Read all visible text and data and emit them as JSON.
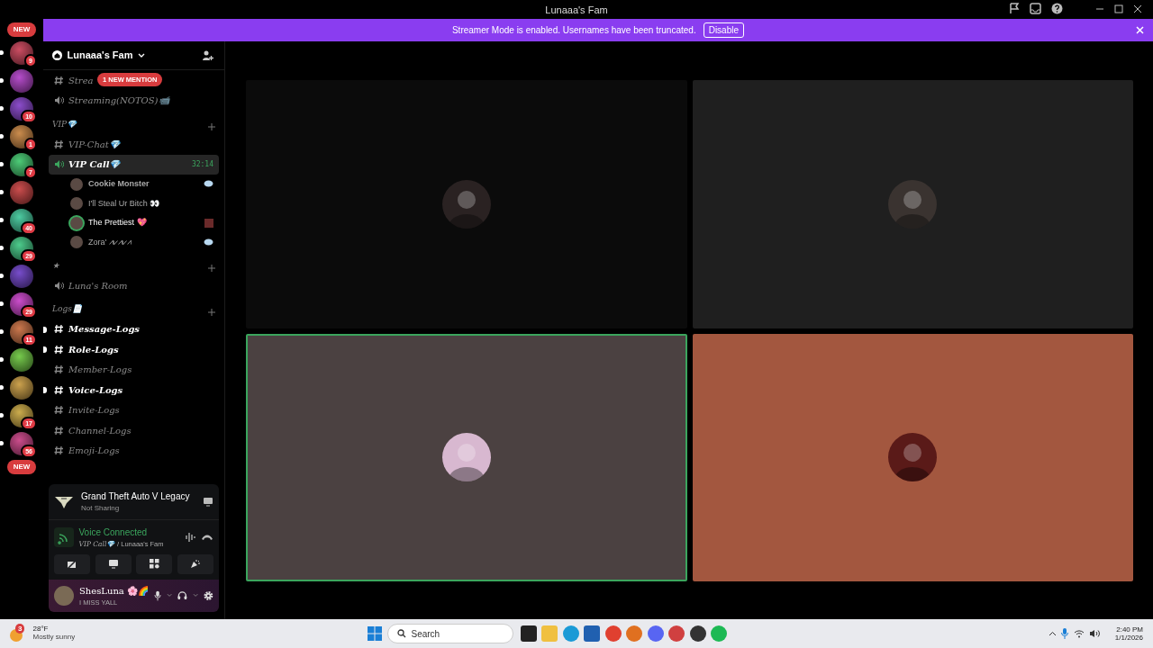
{
  "window": {
    "title": "Lunaaa's Fam"
  },
  "banner": {
    "text": "Streamer Mode is enabled. Usernames have been truncated.",
    "button": "Disable"
  },
  "servers": {
    "top_pill": "NEW",
    "bottom_pill": "NEW",
    "items": [
      {
        "badge": "9",
        "unread": true
      },
      {
        "unread": true
      },
      {
        "badge": "10",
        "unread": true
      },
      {
        "badge": "1",
        "unread": true
      },
      {
        "badge": "7",
        "unread": true
      },
      {
        "unread": true
      },
      {
        "badge": "40",
        "unread": true
      },
      {
        "badge": "29",
        "unread": true
      },
      {
        "unread": true
      },
      {
        "badge": "29",
        "unread": true
      },
      {
        "badge": "11",
        "unread": true
      },
      {
        "unread": true
      },
      {
        "unread": true
      },
      {
        "badge": "17",
        "unread": true
      },
      {
        "badge": "56",
        "unread": true
      }
    ]
  },
  "guild": {
    "name": "Lunaaa's Fam",
    "mention_pill": "1 NEW MENTION"
  },
  "channels": [
    {
      "kind": "text",
      "name": "Strea",
      "unread": false,
      "selected": false
    },
    {
      "kind": "voice",
      "name": "Streaming(NOTOS)📹",
      "unread": false,
      "selected": false
    },
    {
      "kind": "category",
      "name": "VIP💎"
    },
    {
      "kind": "text",
      "name": "VIP-Chat💎",
      "unread": false,
      "selected": false
    },
    {
      "kind": "voice",
      "name": "VIP Call💎",
      "unread": true,
      "selected": true,
      "timer": "32:14",
      "children": [
        {
          "name": "Cookie Monster",
          "speaking": false,
          "streaming": true,
          "video": false
        },
        {
          "name": "I'll Steal Ur Bitch 👀",
          "speaking": false,
          "streaming": false,
          "video": false
        },
        {
          "name": "The Prettiest 💖",
          "speaking": true,
          "streaming": false,
          "video": true
        },
        {
          "name": "Zora' ⩘⩗⩘⩗⩘",
          "speaking": false,
          "streaming": true,
          "video": false
        }
      ]
    },
    {
      "kind": "category",
      "name": "★"
    },
    {
      "kind": "voice",
      "name": "Luna's Room",
      "unread": false,
      "selected": false
    },
    {
      "kind": "category",
      "name": "Logs📄"
    },
    {
      "kind": "text",
      "name": "Message-Logs",
      "unread": true,
      "selected": false
    },
    {
      "kind": "text",
      "name": "Role-Logs",
      "unread": true,
      "selected": false
    },
    {
      "kind": "text",
      "name": "Member-Logs",
      "unread": false,
      "selected": false
    },
    {
      "kind": "text",
      "name": "Voice-Logs",
      "unread": true,
      "selected": false
    },
    {
      "kind": "text",
      "name": "Invite-Logs",
      "unread": false,
      "selected": false
    },
    {
      "kind": "text",
      "name": "Channel-Logs",
      "unread": false,
      "selected": false
    },
    {
      "kind": "text",
      "name": "Emoji-Logs",
      "unread": false,
      "selected": false
    }
  ],
  "activity": {
    "title": "Grand Theft Auto V Legacy",
    "subtitle": "Not Sharing"
  },
  "voice": {
    "status": "Voice Connected",
    "channel": "VIP Call💎",
    "server": "/ Lunaaa's Fam"
  },
  "user": {
    "name": "ShesLuna 🌸🌈",
    "status": "I MISS YALL"
  },
  "tiles": [
    {
      "color": "#0b0b0b",
      "speaking": false
    },
    {
      "color": "#1f1f1f",
      "speaking": false
    },
    {
      "color": "#4b4141",
      "speaking": true
    },
    {
      "color": "#a3573f",
      "speaking": false
    }
  ],
  "taskbar": {
    "weather_badge": "3",
    "temperature": "28°F",
    "condition": "Mostly sunny",
    "search": "Search",
    "time": "2:40 PM",
    "date": "1/1/2026"
  }
}
